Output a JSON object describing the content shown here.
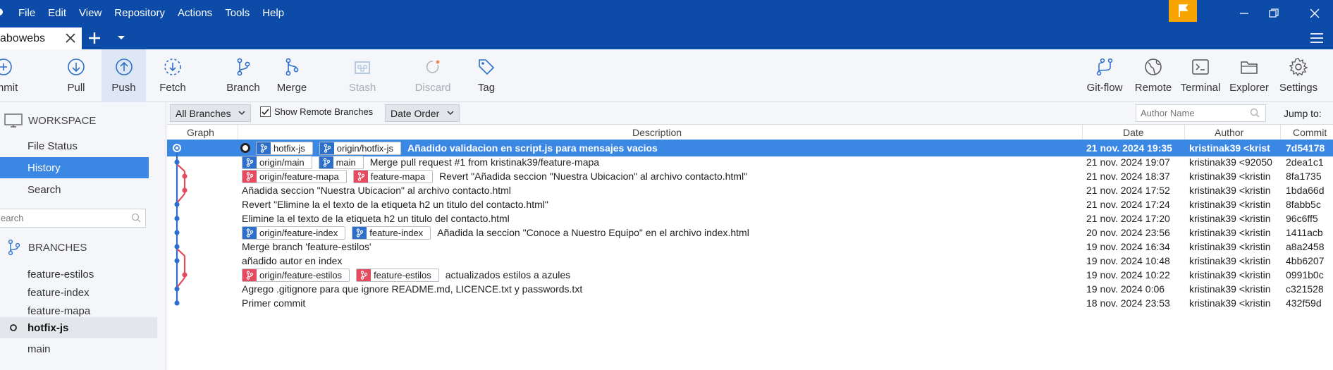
{
  "menu": [
    "File",
    "Edit",
    "View",
    "Repository",
    "Actions",
    "Tools",
    "Help"
  ],
  "tab": {
    "label": "abowebs"
  },
  "toolbar": {
    "left": [
      {
        "id": "commit",
        "label": "mmit",
        "icon": "plus-circle-icon"
      },
      {
        "id": "pull",
        "label": "Pull",
        "icon": "arrow-down-circle-icon"
      },
      {
        "id": "push",
        "label": "Push",
        "icon": "arrow-up-circle-icon"
      },
      {
        "id": "fetch",
        "label": "Fetch",
        "icon": "fetch-dashed-circle-icon"
      },
      {
        "id": "branch",
        "label": "Branch",
        "icon": "branch-icon"
      },
      {
        "id": "merge",
        "label": "Merge",
        "icon": "merge-icon"
      },
      {
        "id": "stash",
        "label": "Stash",
        "icon": "stash-icon"
      },
      {
        "id": "discard",
        "label": "Discard",
        "icon": "discard-icon"
      },
      {
        "id": "tag",
        "label": "Tag",
        "icon": "tag-icon"
      }
    ],
    "right": [
      {
        "id": "gitflow",
        "label": "Git-flow",
        "icon": "gitflow-icon"
      },
      {
        "id": "remote",
        "label": "Remote",
        "icon": "globe-icon"
      },
      {
        "id": "terminal",
        "label": "Terminal",
        "icon": "terminal-icon"
      },
      {
        "id": "explorer",
        "label": "Explorer",
        "icon": "folder-icon"
      },
      {
        "id": "settings",
        "label": "Settings",
        "icon": "gear-icon"
      }
    ]
  },
  "sidebar": {
    "workspace_title": "WORKSPACE",
    "workspace_items": [
      "File Status",
      "History",
      "Search"
    ],
    "selected_item": "History",
    "search_placeholder": "earch",
    "branches_title": "BRANCHES",
    "branches": [
      "feature-estilos",
      "feature-index",
      "feature-mapa",
      "hotfix-js",
      "main"
    ],
    "current_branch": "hotfix-js"
  },
  "filters": {
    "branches_select": "All Branches",
    "show_remote_label": "Show Remote Branches",
    "show_remote_checked": true,
    "order_select": "Date Order",
    "author_placeholder": "Author Name",
    "jump_to_label": "Jump to:"
  },
  "columns": {
    "graph": "Graph",
    "description": "Description",
    "date": "Date",
    "author": "Author",
    "commit": "Commit"
  },
  "commits": [
    {
      "head": true,
      "selected": true,
      "badges": [
        {
          "text": "hotfix-js",
          "color": "blue"
        },
        {
          "text": "origin/hotfix-js",
          "color": "blue"
        }
      ],
      "message": "Añadido validacion en script.js para mensajes vacios",
      "date": "21 nov. 2024 19:35",
      "author": "kristinak39 <krist",
      "sha": "7d54178"
    },
    {
      "badges": [
        {
          "text": "origin/main",
          "color": "blue"
        },
        {
          "text": "main",
          "color": "blue"
        }
      ],
      "message": "Merge pull request #1 from kristinak39/feature-mapa",
      "date": "21 nov. 2024 19:07",
      "author": "kristinak39 <92050",
      "sha": "2dea1c1"
    },
    {
      "badges": [
        {
          "text": "origin/feature-mapa",
          "color": "red"
        },
        {
          "text": "feature-mapa",
          "color": "red"
        }
      ],
      "message": "Revert \"Añadida seccion \"Nuestra Ubicacion\" al archivo contacto.html\"",
      "date": "21 nov. 2024 18:37",
      "author": "kristinak39 <kristin",
      "sha": "8fa1735"
    },
    {
      "badges": [],
      "message": "Añadida seccion \"Nuestra Ubicacion\" al archivo contacto.html",
      "date": "21 nov. 2024 17:52",
      "author": "kristinak39 <kristin",
      "sha": "1bda66d"
    },
    {
      "badges": [],
      "message": "Revert \"Elimine la el texto de la etiqueta h2 un titulo del contacto.html\"",
      "date": "21 nov. 2024 17:24",
      "author": "kristinak39 <kristin",
      "sha": "8fabb5c"
    },
    {
      "badges": [],
      "message": "Elimine la el texto de la etiqueta h2 un titulo del contacto.html",
      "date": "21 nov. 2024 17:20",
      "author": "kristinak39 <kristin",
      "sha": "96c6ff5"
    },
    {
      "badges": [
        {
          "text": "origin/feature-index",
          "color": "blue"
        },
        {
          "text": "feature-index",
          "color": "blue"
        }
      ],
      "message": "Añadida la seccion \"Conoce a Nuestro Equipo\" en el archivo index.html",
      "date": "20 nov. 2024 23:56",
      "author": "kristinak39 <kristin",
      "sha": "1411acb"
    },
    {
      "badges": [],
      "message": "Merge branch 'feature-estilos'",
      "date": "19 nov. 2024 16:34",
      "author": "kristinak39 <kristin",
      "sha": "a8a2458"
    },
    {
      "badges": [],
      "message": "añadido autor en index",
      "date": "19 nov. 2024 10:48",
      "author": "kristinak39 <kristin",
      "sha": "4bb6207"
    },
    {
      "badges": [
        {
          "text": "origin/feature-estilos",
          "color": "red"
        },
        {
          "text": "feature-estilos",
          "color": "red"
        }
      ],
      "message": "actualizados estilos a azules",
      "date": "19 nov. 2024 10:22",
      "author": "kristinak39 <kristin",
      "sha": "0991b0c"
    },
    {
      "badges": [],
      "message": "Agrego .gitignore para que ignore README.md, LICENCE.txt y passwords.txt",
      "date": "19 nov. 2024 0:06",
      "author": "kristinak39 <kristin",
      "sha": "c321528"
    },
    {
      "badges": [],
      "message": "Primer commit",
      "date": "18 nov. 2024 23:53",
      "author": "kristinak39 <kristin",
      "sha": "432f59d"
    }
  ],
  "colors": {
    "titlebar": "#0c4ca8",
    "selection": "#3b87e4",
    "branch_blue": "#2d6fc9",
    "branch_red": "#e64a5f",
    "flag": "#f7a400"
  }
}
